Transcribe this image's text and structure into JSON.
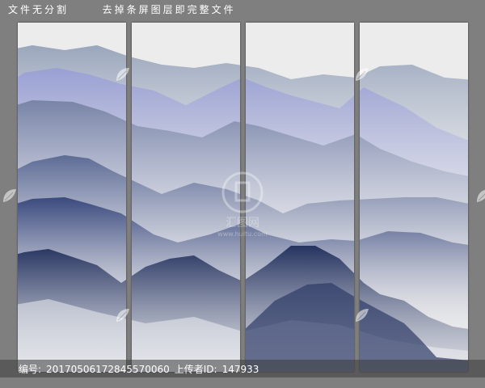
{
  "header": {
    "part1": "文件无分割",
    "part2": "去掉条屏图层即完整文件"
  },
  "footer": {
    "id_label": "编号:",
    "id_value": "20170506172845570060",
    "uploader_label": "上传者ID:",
    "uploader_value": "147933"
  },
  "watermark": {
    "brand_text": "汇图网",
    "brand_url": "www.huitu.com"
  },
  "colors": {
    "background": "#7f7f7f",
    "panel": "#ececec",
    "mist": "#f1f1f1",
    "mountain_far": "#9aa6bc",
    "mountain_lavender": "#9aa0d4",
    "mountain_mid": "#5d6b95",
    "mountain_dark": "#2f4074",
    "mountain_darkest": "#25335f"
  },
  "icons": [
    "leaf-watermark-icon",
    "huitu-logo-icon"
  ],
  "panels": [
    "panel-1",
    "panel-2",
    "panel-3",
    "panel-4"
  ]
}
